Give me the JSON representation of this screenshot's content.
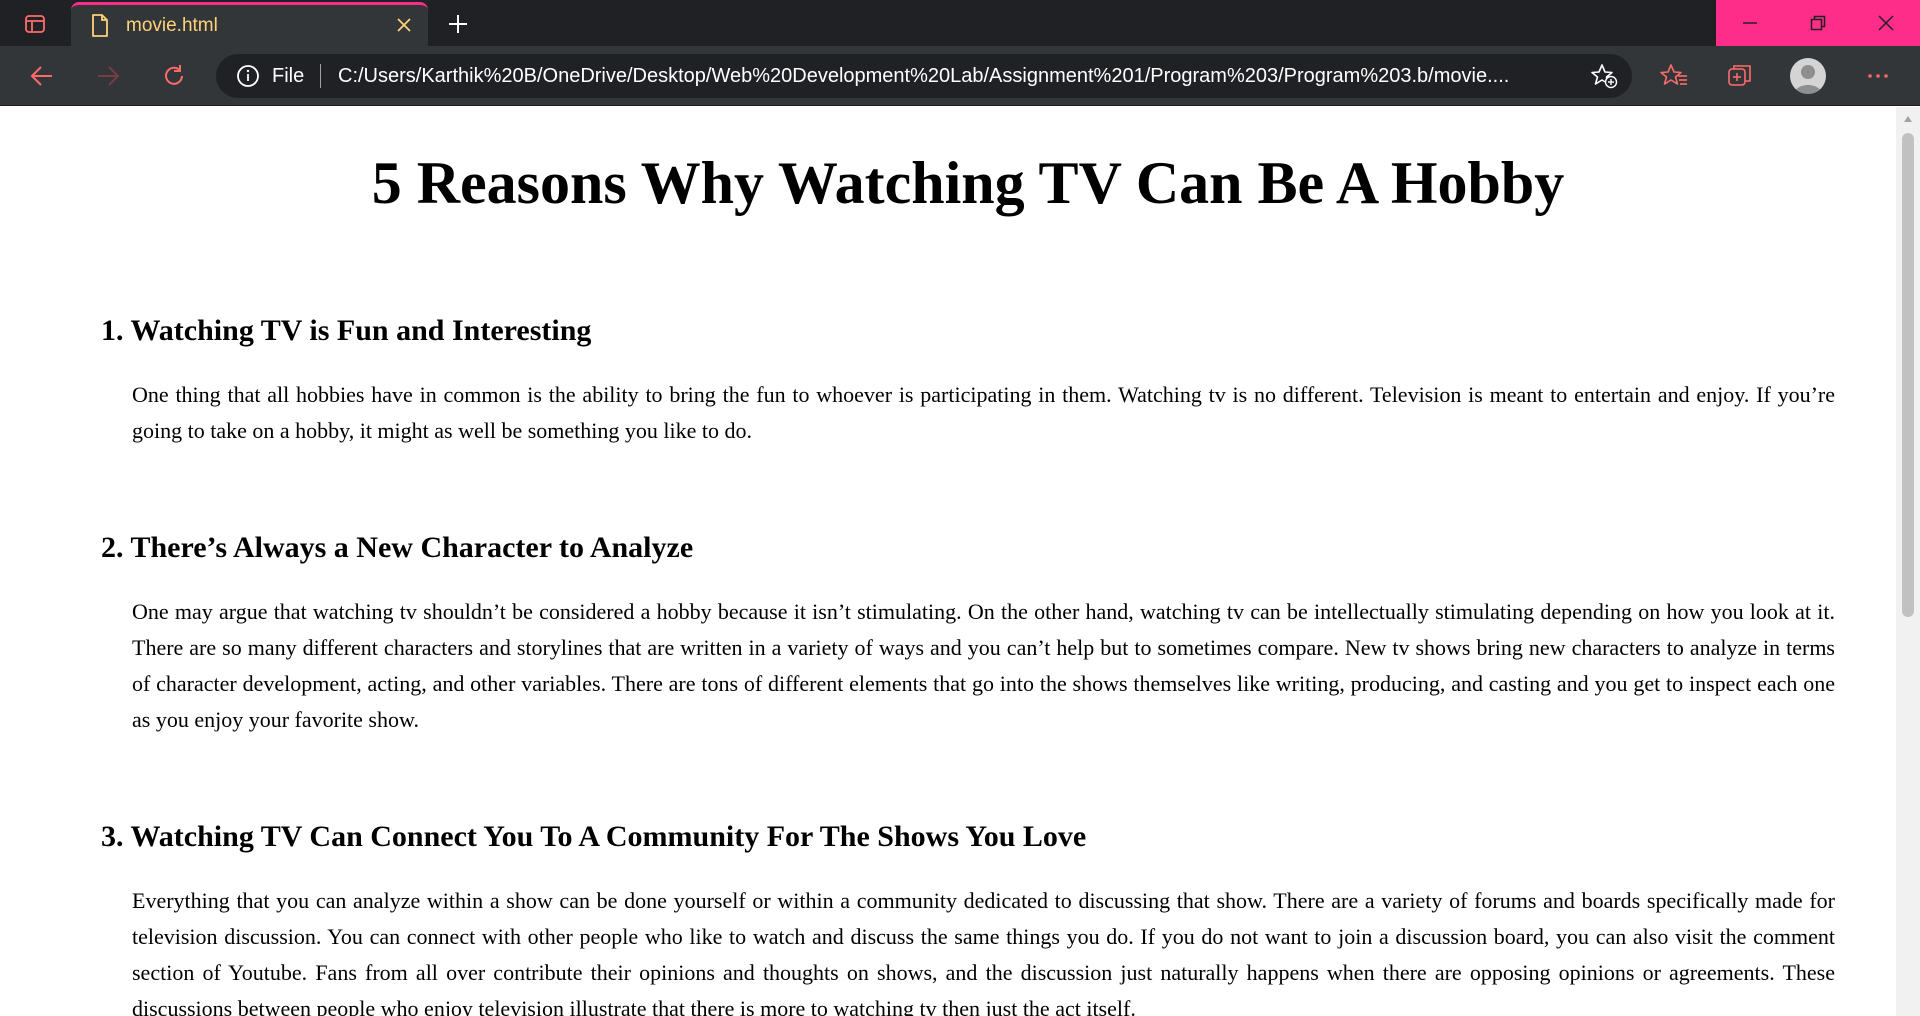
{
  "browser": {
    "tab": {
      "title": "movie.html"
    },
    "address_bar": {
      "scheme_label": "File",
      "url": "C:/Users/Karthik%20B/OneDrive/Desktop/Web%20Development%20Lab/Assignment%201/Program%203/Program%203.b/movie...."
    },
    "accent_color": "#ff2d8a",
    "icons": {
      "tab_actions": "tab-actions-icon",
      "file": "file-icon",
      "close": "close-icon",
      "new_tab": "plus-icon",
      "minimize": "minimize-icon",
      "restore": "restore-icon",
      "close_window": "close-window-icon",
      "back": "back-arrow-icon",
      "forward": "forward-arrow-icon",
      "refresh": "refresh-icon",
      "info": "info-icon",
      "add_favorite": "star-plus-icon",
      "favorites": "favorites-icon",
      "collections": "collections-icon",
      "profile": "avatar-icon",
      "more": "more-icon"
    }
  },
  "page": {
    "title": "5 Reasons Why Watching TV Can Be A Hobby",
    "sections": [
      {
        "heading": "1. Watching TV is Fun and Interesting",
        "body": "One thing that all hobbies have in common is the ability to bring the fun to whoever is participating in them. Watching tv is no different. Television is meant to entertain and enjoy. If you’re going to take on a hobby, it might as well be something you like to do."
      },
      {
        "heading": "2. There’s Always a New Character to Analyze",
        "body": "One may argue that watching tv shouldn’t be considered a hobby because it isn’t stimulating. On the other hand, watching tv can be intellectually stimulating depending on how you look at it. There are so many different characters and storylines that are written in a variety of ways and you can’t help but to sometimes compare. New tv shows bring new characters to analyze in terms of character development, acting, and other variables. There are tons of different elements that go into the shows themselves like writing, producing, and casting and you get to inspect each one as you enjoy your favorite show."
      },
      {
        "heading": "3. Watching TV Can Connect You To A Community For The Shows You Love",
        "body": "Everything that you can analyze within a show can be done yourself or within a community dedicated to discussing that show. There are a variety of forums and boards specifically made for television discussion. You can connect with other people who like to watch and discuss the same things you do. If you do not want to join a discussion board, you can also visit the comment section of Youtube. Fans from all over contribute their opinions and thoughts on shows, and the discussion just naturally happens when there are opposing opinions or agreements. These discussions between people who enjoy television illustrate that there is more to watching tv then just the act itself."
      }
    ]
  }
}
